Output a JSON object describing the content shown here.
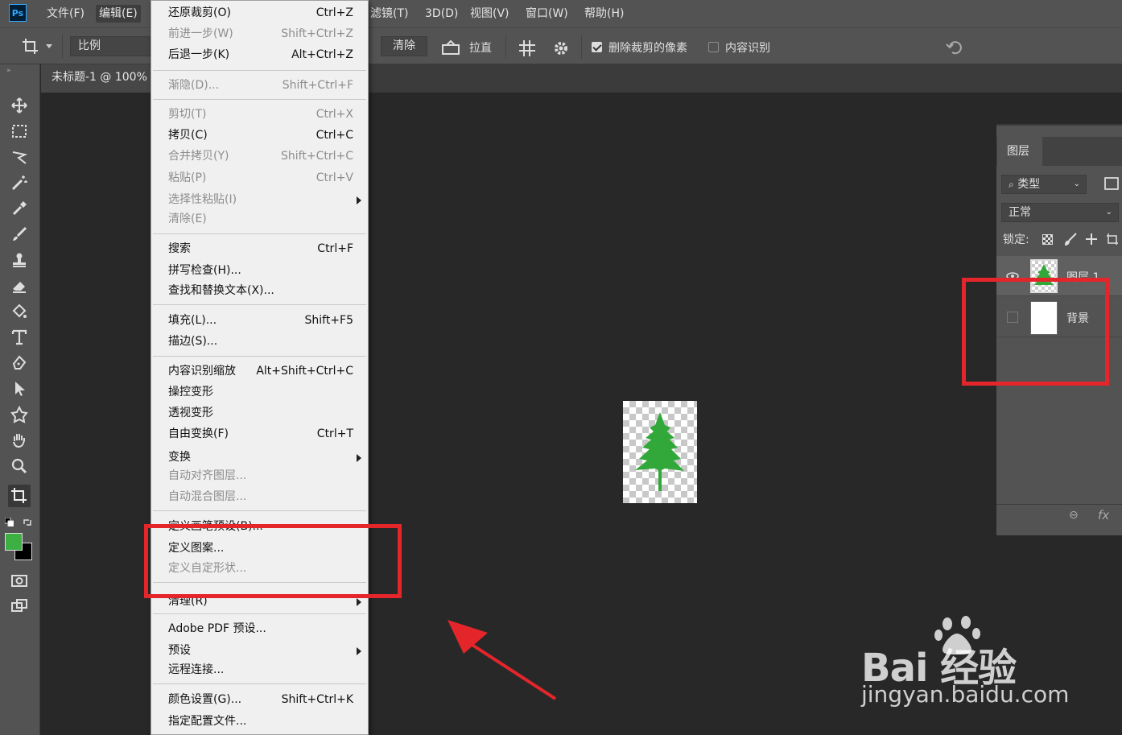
{
  "app": {
    "logo": "Ps"
  },
  "menubar": {
    "items": [
      "文件(F)",
      "编辑(E)",
      "滤镜(T)",
      "3D(D)",
      "视图(V)",
      "窗口(W)",
      "帮助(H)"
    ]
  },
  "options": {
    "ratio_label": "比例",
    "clear_label": "清除",
    "straighten_label": "拉直",
    "delete_cropped_label": "删除裁剪的像素",
    "delete_cropped_checked": true,
    "content_aware_label": "内容识别",
    "content_aware_checked": false
  },
  "document": {
    "tab_title": "未标题-1 @ 100%"
  },
  "edit_menu": {
    "items": [
      {
        "label": "还原裁剪(O)",
        "shortcut": "Ctrl+Z"
      },
      {
        "label": "前进一步(W)",
        "shortcut": "Shift+Ctrl+Z",
        "disabled": true
      },
      {
        "label": "后退一步(K)",
        "shortcut": "Alt+Ctrl+Z"
      },
      {
        "label": "渐隐(D)...",
        "shortcut": "Shift+Ctrl+F",
        "disabled": true
      },
      {
        "label": "剪切(T)",
        "shortcut": "Ctrl+X",
        "disabled": true
      },
      {
        "label": "拷贝(C)",
        "shortcut": "Ctrl+C"
      },
      {
        "label": "合并拷贝(Y)",
        "shortcut": "Shift+Ctrl+C",
        "disabled": true
      },
      {
        "label": "粘贴(P)",
        "shortcut": "Ctrl+V",
        "disabled": true
      },
      {
        "label": "选择性粘贴(I)",
        "shortcut": "",
        "disabled": true,
        "submenu": true
      },
      {
        "label": "清除(E)",
        "shortcut": "",
        "disabled": true
      },
      {
        "label": "搜索",
        "shortcut": "Ctrl+F"
      },
      {
        "label": "拼写检查(H)...",
        "shortcut": ""
      },
      {
        "label": "查找和替换文本(X)...",
        "shortcut": ""
      },
      {
        "label": "填充(L)...",
        "shortcut": "Shift+F5"
      },
      {
        "label": "描边(S)...",
        "shortcut": ""
      },
      {
        "label": "内容识别缩放",
        "shortcut": "Alt+Shift+Ctrl+C"
      },
      {
        "label": "操控变形",
        "shortcut": ""
      },
      {
        "label": "透视变形",
        "shortcut": ""
      },
      {
        "label": "自由变换(F)",
        "shortcut": "Ctrl+T"
      },
      {
        "label": "变换",
        "shortcut": "",
        "submenu": true
      },
      {
        "label": "自动对齐图层...",
        "shortcut": "",
        "disabled": true
      },
      {
        "label": "自动混合图层...",
        "shortcut": "",
        "disabled": true
      },
      {
        "label": "定义画笔预设(B)...",
        "shortcut": ""
      },
      {
        "label": "定义图案...",
        "shortcut": ""
      },
      {
        "label": "定义自定形状...",
        "shortcut": "",
        "disabled": true
      },
      {
        "label": "清理(R)",
        "shortcut": "",
        "submenu": true
      },
      {
        "label": "Adobe PDF 预设...",
        "shortcut": ""
      },
      {
        "label": "预设",
        "shortcut": "",
        "submenu": true
      },
      {
        "label": "远程连接...",
        "shortcut": ""
      },
      {
        "label": "颜色设置(G)...",
        "shortcut": "Shift+Ctrl+K"
      },
      {
        "label": "指定配置文件...",
        "shortcut": ""
      }
    ]
  },
  "layers_panel": {
    "tab_label": "图层",
    "filter_label": "类型",
    "blend_mode": "正常",
    "lock_label": "锁定:",
    "layers": [
      {
        "name": "图层 1",
        "visible": true
      },
      {
        "name": "背景",
        "visible": false
      }
    ],
    "footer_fx": "fx"
  },
  "colors": {
    "foreground": "#3cb043",
    "background": "#000000",
    "annotation": "#e4262b",
    "tree": "#33a83a"
  },
  "watermark": {
    "brand": "Bai  经验",
    "url": "jingyan.baidu.com"
  }
}
